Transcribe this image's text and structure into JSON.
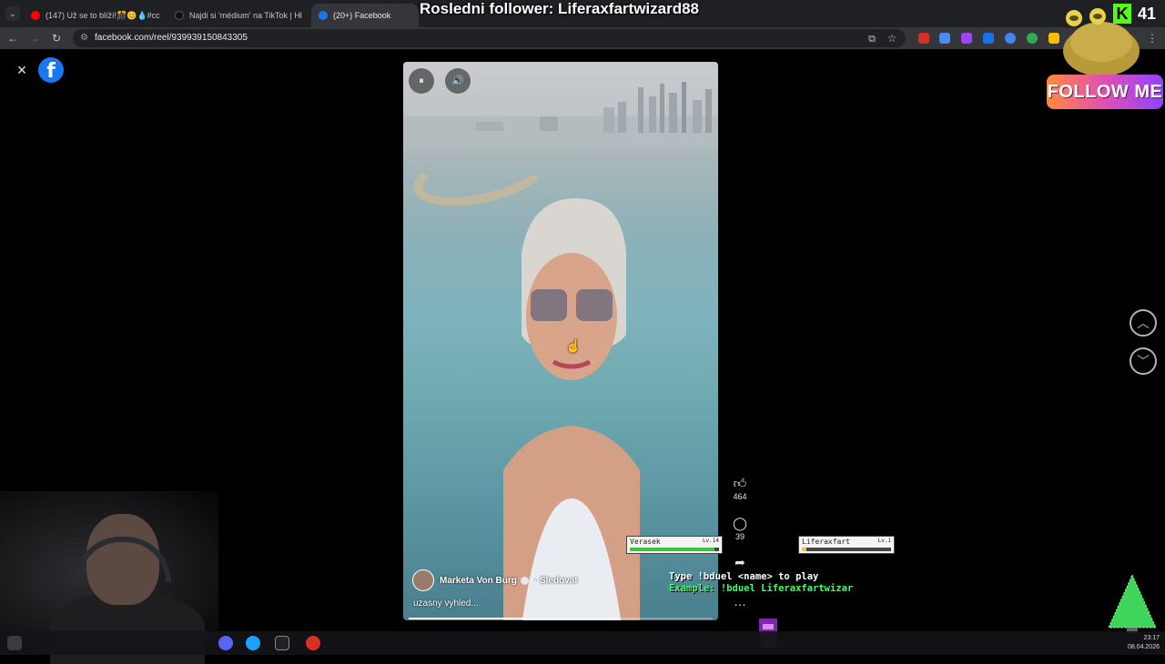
{
  "browser": {
    "tabs": [
      {
        "title": "(147) Už se to blíží!🎊😊💧#cc",
        "favicon_color": "#ff0000"
      },
      {
        "title": "Najdi si 'médium' na TikTok | Hl",
        "favicon_color": "#111111"
      },
      {
        "title": "(20+) Facebook",
        "favicon_color": "#1877f2",
        "active": true
      }
    ],
    "url": "facebook.com/reel/939939150843305"
  },
  "stream_overlay": {
    "title": "Rosledni follower: Liferaxfartwizard88",
    "follow_badge": "FOLLOW ME",
    "viewer_count": "41",
    "kick_logo": "K",
    "duel_line1": "Type !bduel <name> to play",
    "duel_line2": "Example: !bduel Liferaxfartwizar",
    "player1": {
      "name": "Verasek",
      "level": "Lv.14",
      "hp": 0.95
    },
    "player2": {
      "name": "Liferaxfart",
      "level": "Lv.1",
      "hp": 0.05
    }
  },
  "facebook": {
    "close_icon": "×",
    "logo": "f",
    "reel": {
      "author": "Marketa Von Burg",
      "follow_label": "· Sledovat",
      "caption": "uzasny vyhled...",
      "progress": 0.38,
      "pause_icon": "⏸",
      "volume_icon": "🔊"
    },
    "actions": {
      "like_count": "464",
      "comment_count": "39",
      "more_icon": "…"
    }
  },
  "system": {
    "time": "23:17",
    "date": "08.04.2026"
  }
}
